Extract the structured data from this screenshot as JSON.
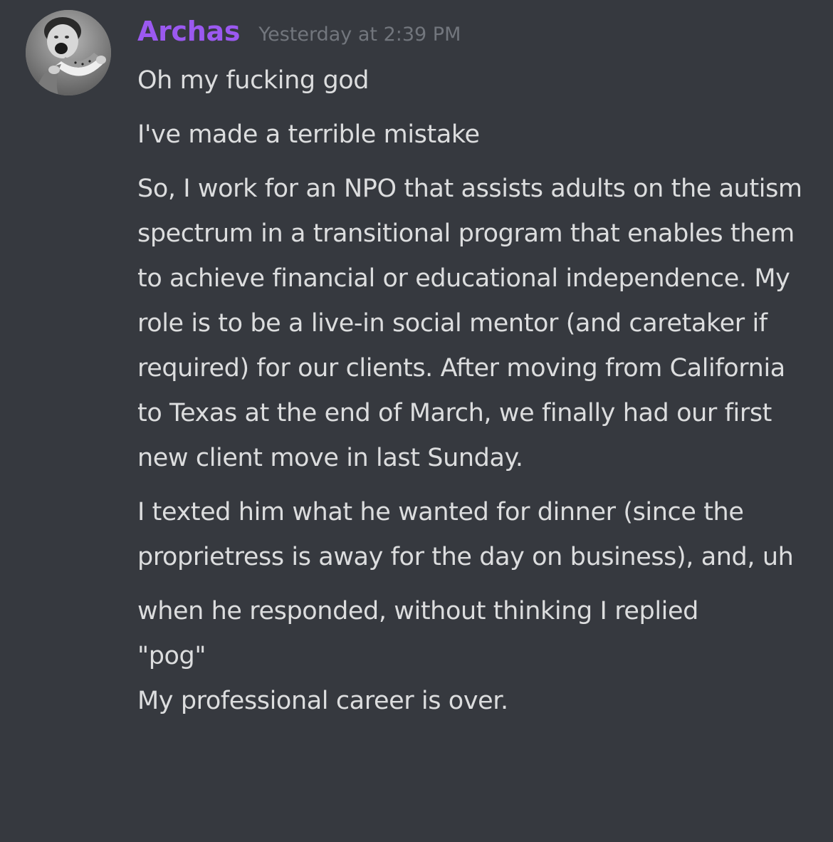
{
  "author": {
    "name": "Archas",
    "timestamp": "Yesterday at 2:39 PM",
    "name_color": "#9b59f0",
    "avatar_icon": "user-avatar-photo"
  },
  "theme": {
    "background": "#36393f",
    "text": "#dcddde",
    "muted": "#72767d"
  },
  "messages": [
    "Oh my fucking god",
    "I've made a terrible mistake",
    "So, I work for an NPO that assists adults on the autism spectrum in a transitional program that enables them to achieve financial or educational independence. My role is to be a live-in social mentor (and caretaker if required) for our clients. After moving from California to Texas at the end of March, we finally had our first new client move in last Sunday.",
    "I texted him what he wanted for dinner (since the proprietress is away for the day on business), and, uh",
    "when he responded, without thinking I replied",
    "\"pog\"",
    "My professional career is over."
  ]
}
